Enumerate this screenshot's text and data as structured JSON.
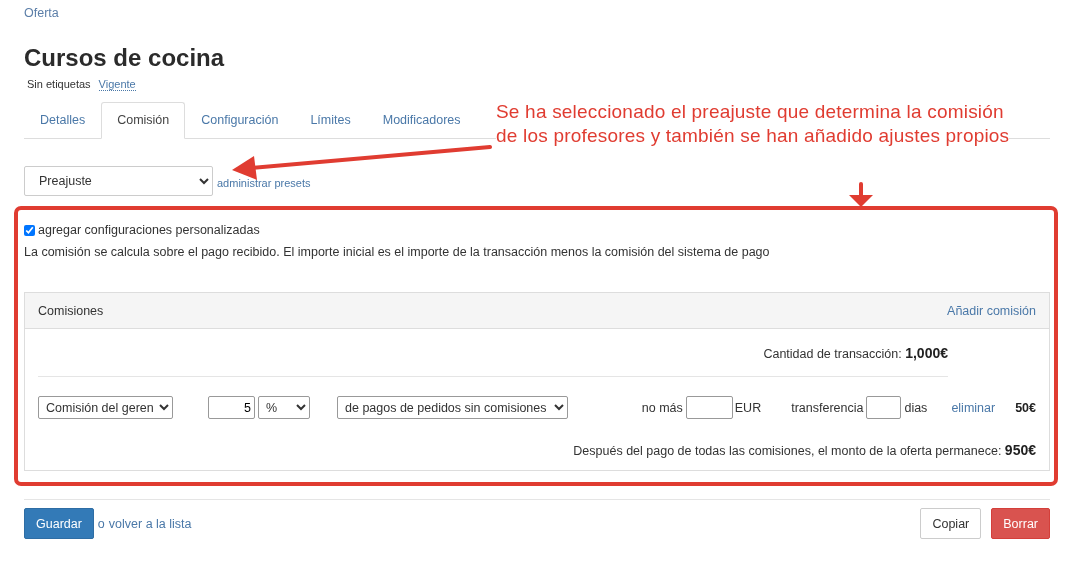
{
  "breadcrumb": "Oferta",
  "title": "Cursos de cocina",
  "tags_label": "Sin etiquetas",
  "status": "Vigente",
  "tabs": [
    {
      "label": "Detalles",
      "selected": false
    },
    {
      "label": "Comisión",
      "selected": true
    },
    {
      "label": "Configuración",
      "selected": false
    },
    {
      "label": "Límites",
      "selected": false
    },
    {
      "label": "Modificadores",
      "selected": false
    }
  ],
  "preset": {
    "value": "Preajuste",
    "link": "administrar presets"
  },
  "custom": {
    "checked": true,
    "label": "agregar configuraciones personalizadas"
  },
  "note": "La comisión se calcula sobre el pago recibido. El importe inicial es el importe de la transacción menos la comisión del sistema de pago",
  "commissions": {
    "title": "Comisiones",
    "add": "Añadir comisión",
    "transaction_label": "Cantidad de transacción:",
    "transaction_amount": "1,000€",
    "rows": [
      {
        "type": "Comisión del geren",
        "amount": "5",
        "unit": "%",
        "base": "de pagos de pedidos sin comisiones",
        "max_label": "no más",
        "currency": "EUR",
        "transfer_label": "transferencia",
        "days_label": "dias",
        "remove": "eliminar",
        "total": "50€"
      }
    ],
    "remaining_label": "Después del pago de todas las comisiones, el monto de la oferta permanece:",
    "remaining_amount": "950€"
  },
  "footer": {
    "save": "Guardar",
    "back_prefix": "o",
    "back_link": "volver a la lista",
    "copy": "Copiar",
    "delete": "Borrar"
  },
  "annotation": {
    "lines": [
      "Se ha seleccionado el preajuste que determina la comisión",
      "de los profesores y también se han añadido ajustes propios"
    ]
  }
}
